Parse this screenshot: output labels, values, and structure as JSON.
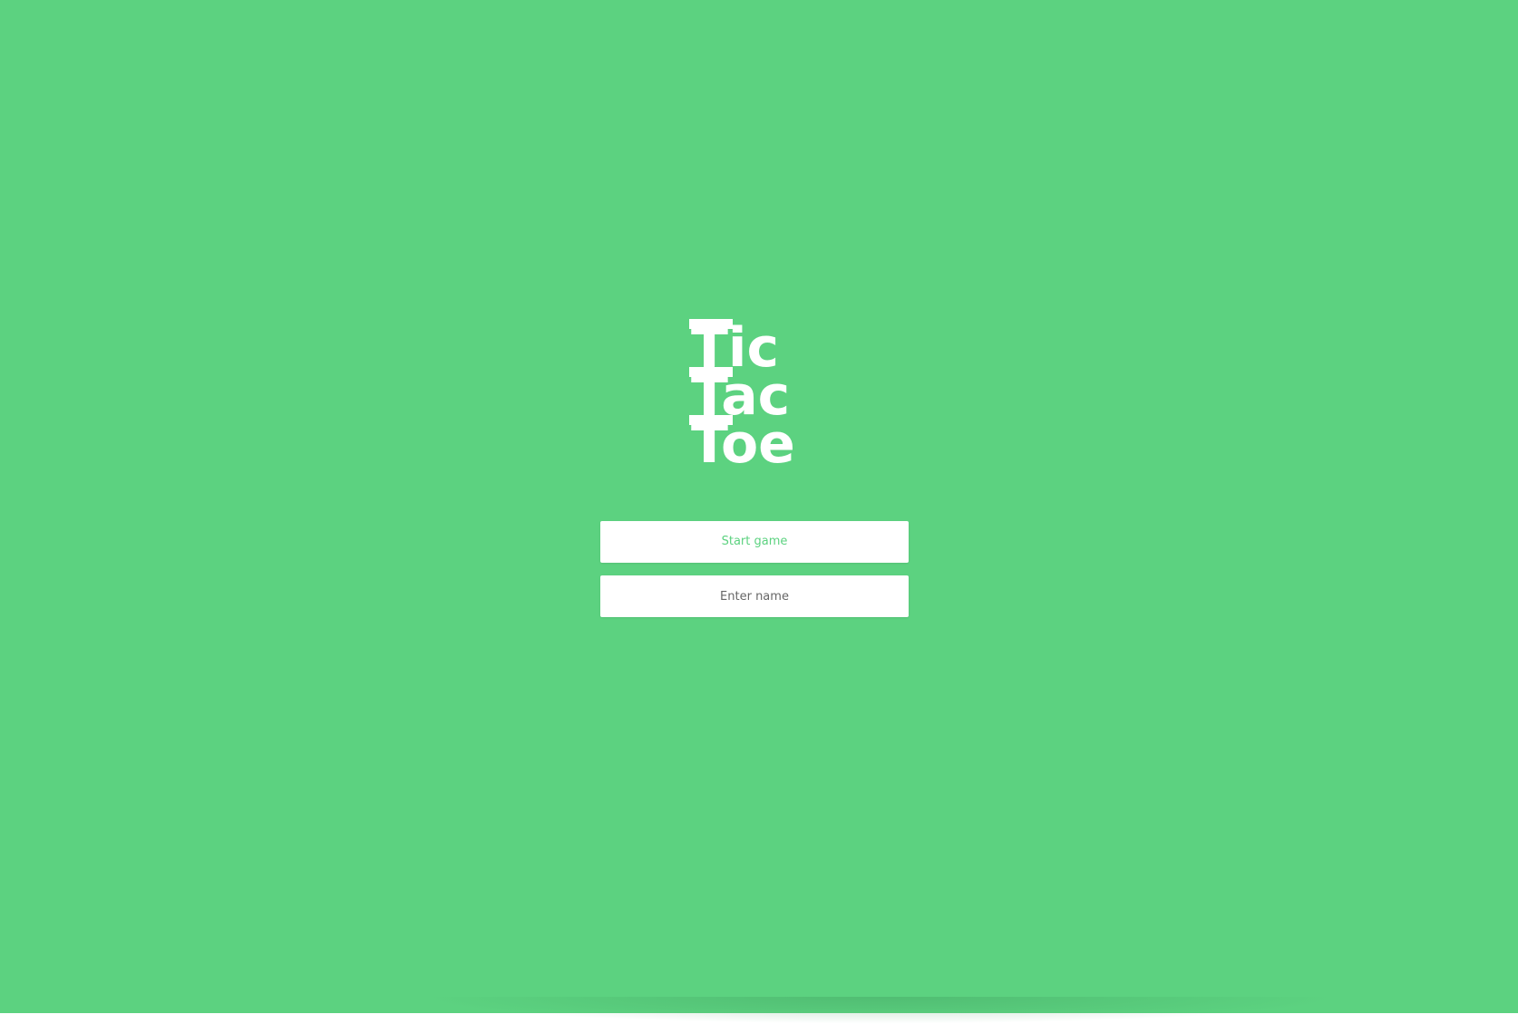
{
  "app": {
    "background_color": "#5cd280",
    "accent_color": "#5cd280"
  },
  "logo": {
    "line1": "Tic",
    "line2": "Tac",
    "line3": "Toe"
  },
  "menu": {
    "start_label": "Start game",
    "name_placeholder": "Enter name",
    "name_value": ""
  }
}
